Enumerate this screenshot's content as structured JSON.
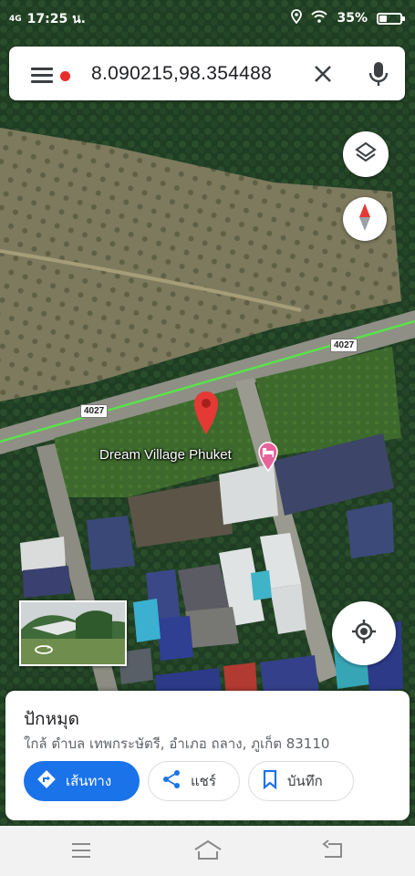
{
  "status_bar": {
    "network": "4G",
    "time": "17:25 น.",
    "battery_percent": "35%",
    "battery_level": 0.35
  },
  "search": {
    "query": "8.090215,98.354488",
    "menu_icon": "hamburger-menu-icon",
    "clear_icon": "close-icon",
    "voice_icon": "microphone-icon",
    "has_notification": true
  },
  "map": {
    "road_labels": [
      "4027",
      "4027"
    ],
    "place_name": "Dream Village Phuket",
    "place_icon": "hotel-bed-icon",
    "pin_icon": "dropped-pin-icon",
    "accent_color": "#1a73e8",
    "pin_color": "#e53935",
    "hotel_pin_color": "#e8639b",
    "road_highlight_color": "#59e34a"
  },
  "controls": {
    "layers_icon": "layers-icon",
    "compass_icon": "compass-icon",
    "location_icon": "my-location-icon",
    "street_view_icon": "rotate-360-icon"
  },
  "sheet": {
    "title": "ปักหมุด",
    "address": "ใกล้ ตำบล เทพกระษัตรี, อำเภอ ถลาง, ภูเก็ต 83110",
    "directions_label": "เส้นทาง",
    "share_label": "แชร์",
    "save_label": "บันทึก"
  },
  "nav_bar": {
    "menu_icon": "menu-icon",
    "home_icon": "home-icon",
    "back_icon": "back-icon"
  }
}
